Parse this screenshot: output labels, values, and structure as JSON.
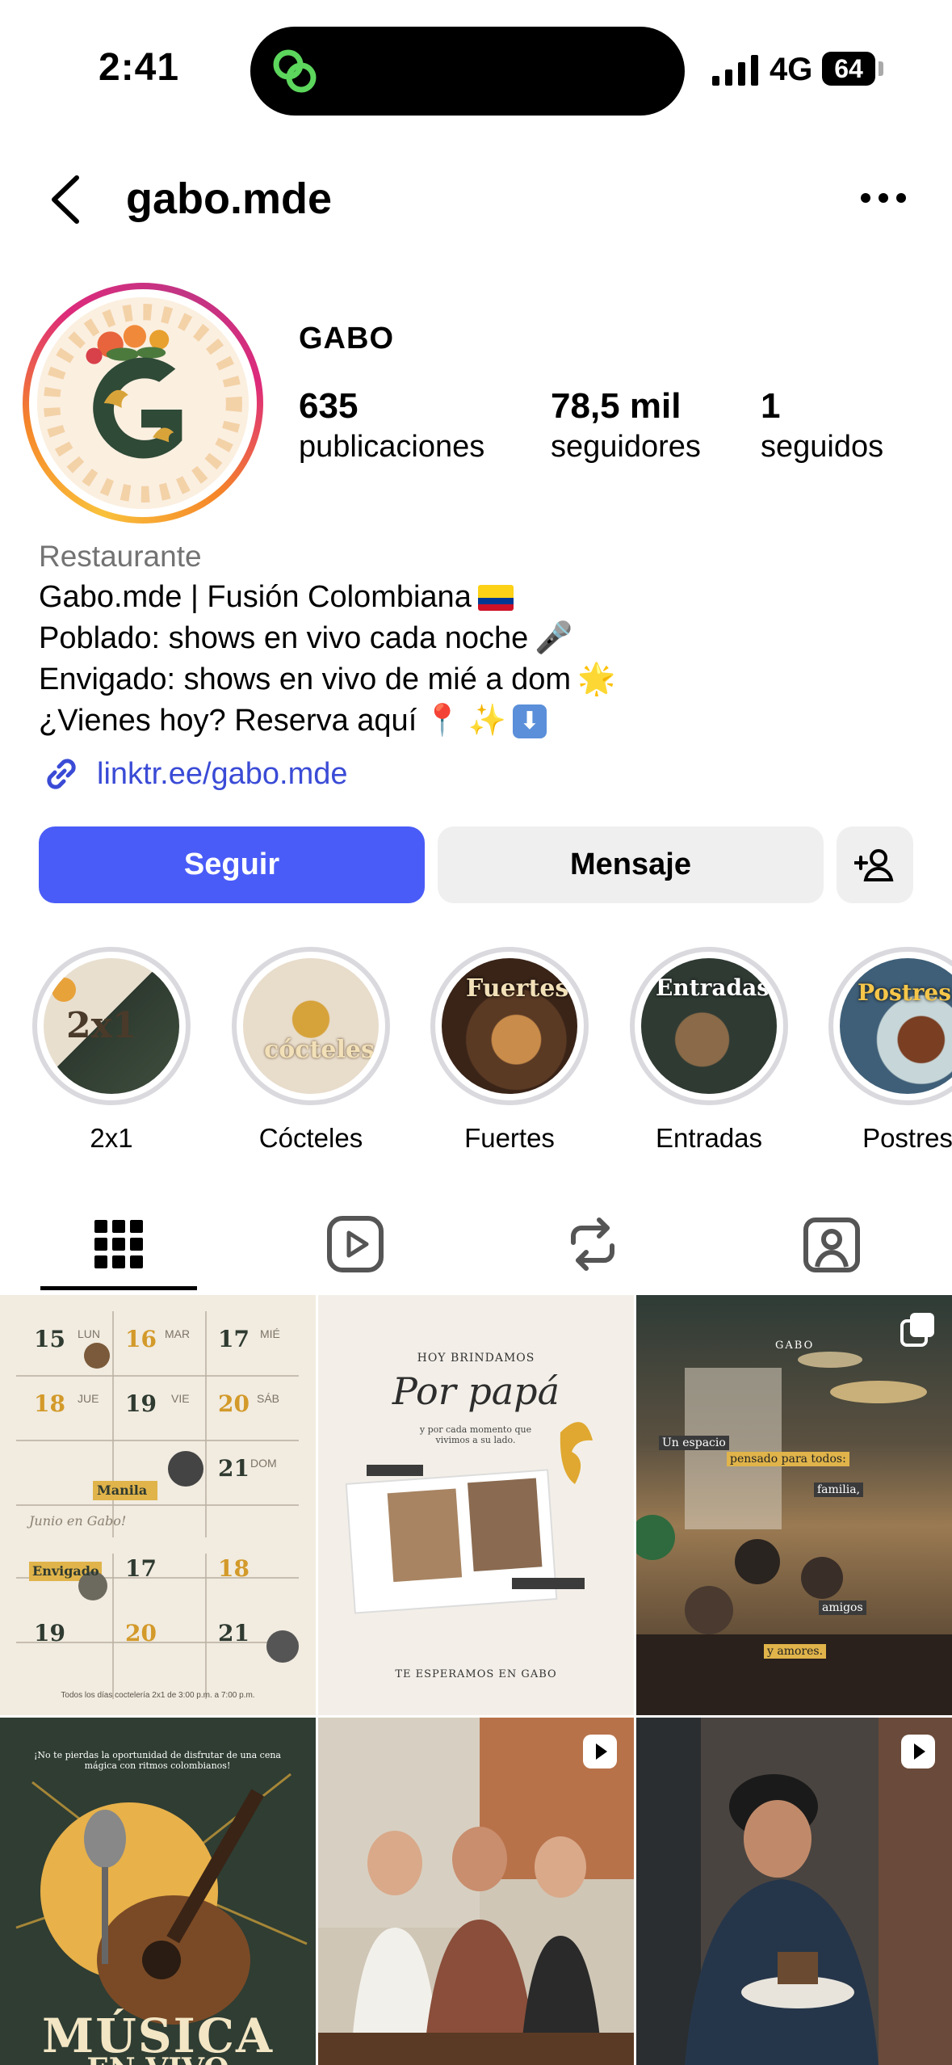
{
  "status_bar": {
    "time": "2:41",
    "network": "4G",
    "battery": "64"
  },
  "nav": {
    "username": "gabo.mde"
  },
  "profile": {
    "display_name": "GABO",
    "stats": [
      {
        "value": "635",
        "label": "publicaciones"
      },
      {
        "value": "78,5 mil",
        "label": "seguidores"
      },
      {
        "value": "1",
        "label": "seguidos"
      }
    ],
    "category": "Restaurante",
    "bio": [
      "Gabo.mde | Fusión Colombiana",
      "Poblado: shows en vivo cada noche",
      "Envigado: shows en vivo de mié a dom",
      "¿Vienes hoy? Reserva aquí"
    ],
    "bio_emojis": [
      "🎤",
      "🌟",
      "📍",
      "✨",
      "⬇"
    ],
    "link": "linktr.ee/gabo.mde"
  },
  "actions": {
    "follow": "Seguir",
    "message": "Mensaje"
  },
  "highlights": [
    {
      "label": "2x1",
      "cover_text": "2x1"
    },
    {
      "label": "Cócteles",
      "cover_text": "cócteles"
    },
    {
      "label": "Fuertes",
      "cover_text": "Fuertes"
    },
    {
      "label": "Entradas",
      "cover_text": "Entradas"
    },
    {
      "label": "Postres",
      "cover_text": "Postres"
    }
  ],
  "tabs": [
    "grid",
    "reels",
    "reposts",
    "tagged"
  ],
  "posts": {
    "calendar": {
      "days": [
        "15",
        "16",
        "17",
        "18",
        "19",
        "20",
        "21",
        "17",
        "18",
        "19",
        "20",
        "21"
      ],
      "weekdays": [
        "LUN",
        "MAR",
        "MIÉ",
        "JUE",
        "VIE",
        "SÁB",
        "DOM"
      ],
      "tags": [
        "Manila",
        "Envigado"
      ],
      "title": "Junio en Gabo!",
      "footer": "Todos los días coctelería 2x1 de 3:00 p.m. a 7:00 p.m."
    },
    "father": {
      "kicker": "HOY BRINDAMOS",
      "title": "Por papá",
      "sub": "y por cada momento que vivimos a su lado.",
      "footer": "TE ESPERAMOS EN GABO"
    },
    "space": {
      "brand": "GABO",
      "lines": [
        "Un espacio",
        "pensado para todos:",
        "familia,",
        "amigos",
        "y amores."
      ]
    },
    "music": {
      "top": "¡No te pierdas la oportunidad de disfrutar de una cena mágica con ritmos colombianos!",
      "title": "MÚSICA",
      "sub": "EN VIVO"
    }
  },
  "colors": {
    "follow_button": "#4a5cf7",
    "link": "#3a4bd6",
    "muted": "#737373",
    "button_grey": "#efefef"
  }
}
